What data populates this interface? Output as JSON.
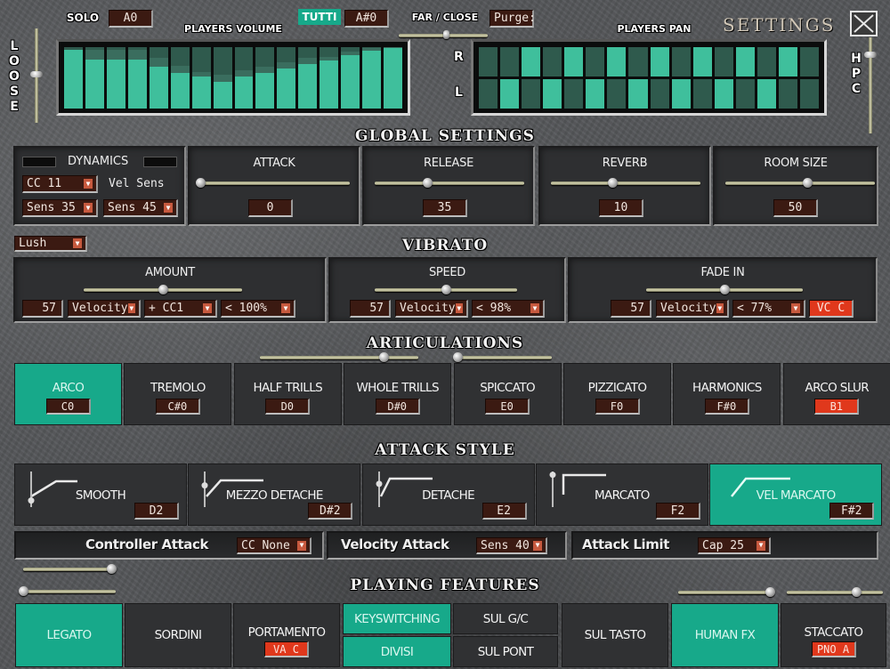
{
  "header": {
    "solo_label": "SOLO",
    "solo_key": "A0",
    "tutti_label": "TUTTI",
    "tutti_key": "A#0",
    "far_close_label": "FAR / CLOSE",
    "far_close_value": 0.55,
    "purge_label": "Purge:",
    "settings_label": "SETTINGS",
    "close_icon": "close-x-icon",
    "loose_label": [
      "L",
      "O",
      "O",
      "S",
      "E"
    ],
    "loose_value": 0.55,
    "hpc_label": [
      "H",
      "P",
      "C"
    ],
    "hpc_value": 0.85
  },
  "players_volume": {
    "title": "PLAYERS VOLUME",
    "levels": [
      0.96,
      0.8,
      0.8,
      0.8,
      0.68,
      0.58,
      0.52,
      0.44,
      0.52,
      0.58,
      0.65,
      0.72,
      0.78,
      0.87,
      0.94,
      0.99
    ],
    "ghost_levels": [
      0.96,
      0.96,
      0.96,
      0.96,
      0.82,
      0.7,
      0.6,
      0.55,
      0.62,
      0.68,
      0.76,
      0.82,
      0.84,
      0.93,
      0.98,
      1.0
    ]
  },
  "players_pan": {
    "title": "PLAYERS PAN",
    "r_label": "R",
    "l_label": "L",
    "right_lit": [
      false,
      false,
      true,
      false,
      true,
      false,
      true,
      false,
      true,
      false,
      true,
      false,
      true,
      false,
      true,
      false
    ],
    "left_lit": [
      false,
      true,
      false,
      true,
      false,
      true,
      false,
      true,
      false,
      true,
      false,
      true,
      false,
      true,
      false,
      false
    ]
  },
  "global_settings": {
    "title": "GLOBAL SETTINGS",
    "dynamics": {
      "label": "DYNAMICS",
      "cc": "CC 11",
      "vel_sens_label": "Vel Sens",
      "sens_a": "Sens 35",
      "sens_b": "Sens 45"
    },
    "attack": {
      "label": "ATTACK",
      "value": "0",
      "position": 0.0
    },
    "release": {
      "label": "RELEASE",
      "value": "35",
      "position": 0.35
    },
    "reverb": {
      "label": "REVERB",
      "value": "10",
      "position": 0.41
    },
    "room_size": {
      "label": "ROOM SIZE",
      "value": "50",
      "position": 0.55
    }
  },
  "vibrato": {
    "title": "VIBRATO",
    "preset": "Lush",
    "amount": {
      "label": "AMOUNT",
      "value": "57",
      "mode": "Velocity",
      "mod": "+ CC1",
      "limit": "< 100%",
      "position": 0.5
    },
    "speed": {
      "label": "SPEED",
      "value": "57",
      "mode": "Velocity",
      "limit": "< 98%",
      "position": 0.5
    },
    "fade_in": {
      "label": "FADE IN",
      "value": "57",
      "mode": "Velocity",
      "limit": "< 77%",
      "key": "VC C",
      "position": 0.5
    }
  },
  "articulations": {
    "title": "ARTICULATIONS",
    "slider_a": 0.78,
    "slider_b": 0.0,
    "items": [
      {
        "label": "ARCO",
        "key": "C0",
        "active": true,
        "key_red": false
      },
      {
        "label": "TREMOLO",
        "key": "C#0",
        "active": false,
        "key_red": false
      },
      {
        "label": "HALF TRILLS",
        "key": "D0",
        "active": false,
        "key_red": false
      },
      {
        "label": "WHOLE TRILLS",
        "key": "D#0",
        "active": false,
        "key_red": false
      },
      {
        "label": "SPICCATO",
        "key": "E0",
        "active": false,
        "key_red": false
      },
      {
        "label": "PIZZICATO",
        "key": "F0",
        "active": false,
        "key_red": false
      },
      {
        "label": "HARMONICS",
        "key": "F#0",
        "active": false,
        "key_red": false
      },
      {
        "label": "ARCO SLUR",
        "key": "B1",
        "active": false,
        "key_red": true
      }
    ]
  },
  "attack_style": {
    "title": "ATTACK STYLE",
    "items": [
      {
        "label": "SMOOTH",
        "key": "D2",
        "active": false
      },
      {
        "label": "MEZZO DETACHE",
        "key": "D#2",
        "active": false
      },
      {
        "label": "DETACHE",
        "key": "E2",
        "active": false
      },
      {
        "label": "MARCATO",
        "key": "F2",
        "active": false
      },
      {
        "label": "VEL MARCATO",
        "key": "F#2",
        "active": true
      }
    ],
    "controller_attack_label": "Controller Attack",
    "controller_attack_value": "CC None",
    "velocity_attack_label": "Velocity Attack",
    "velocity_attack_value": "Sens 40",
    "attack_limit_label": "Attack Limit",
    "attack_limit_value": "Cap 25"
  },
  "playing_features": {
    "title": "PLAYING FEATURES",
    "slider_left_a": 0.95,
    "slider_left_b": 0.0,
    "slider_right_a": 0.95,
    "slider_right_b": 0.72,
    "items": {
      "legato": {
        "label": "LEGATO",
        "active": true
      },
      "sordini": {
        "label": "SORDINI",
        "active": false
      },
      "portamento": {
        "label": "PORTAMENTO",
        "key": "VA C",
        "active": false
      },
      "keyswitching": {
        "label": "KEYSWITCHING",
        "active": true
      },
      "divisi": {
        "label": "DIVISI",
        "active": true
      },
      "sul_gc": {
        "label": "SUL G/C",
        "active": false
      },
      "sul_pont": {
        "label": "SUL PONT",
        "active": false
      },
      "sul_tasto": {
        "label": "SUL TASTO",
        "active": false
      },
      "human_fx": {
        "label": "HUMAN FX",
        "active": true
      },
      "staccato": {
        "label": "STACCATO",
        "key": "PNO A",
        "active": false
      }
    }
  },
  "colors": {
    "accent": "#17a98a",
    "meter_lit": "#3fbf9c",
    "meter_dim": "#2f5a4d",
    "lcd_bg": "#3b1a12",
    "alert_red": "#e0381c"
  }
}
